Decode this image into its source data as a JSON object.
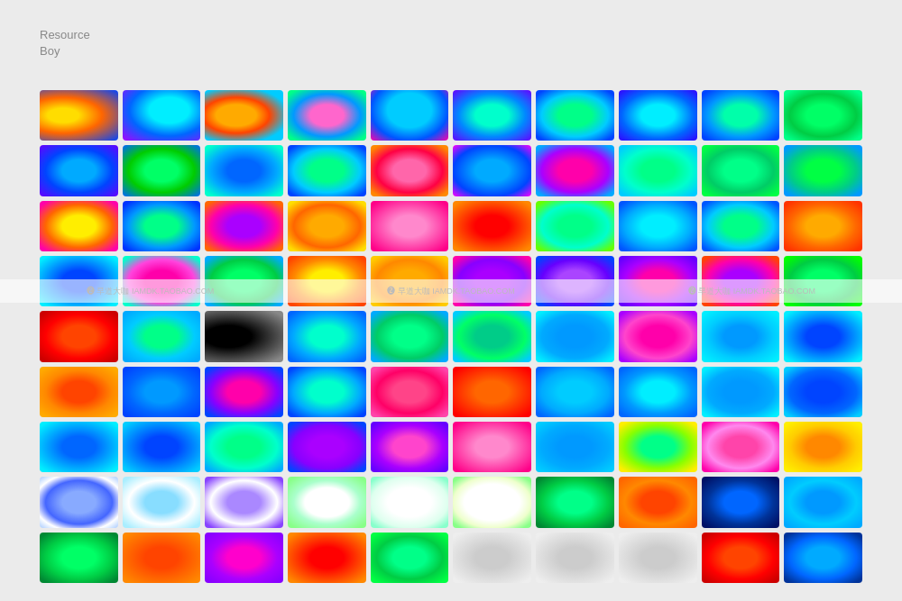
{
  "app": {
    "title_line1": "Resource",
    "title_line2": "Boy"
  },
  "watermarks": [
    "早道大咖  IAMDK.TAOBAO.COM",
    "早道大咖  IAMDK.TAOBAO.COM",
    "早道大咖  IAMDK.TAOBAO.COM"
  ]
}
